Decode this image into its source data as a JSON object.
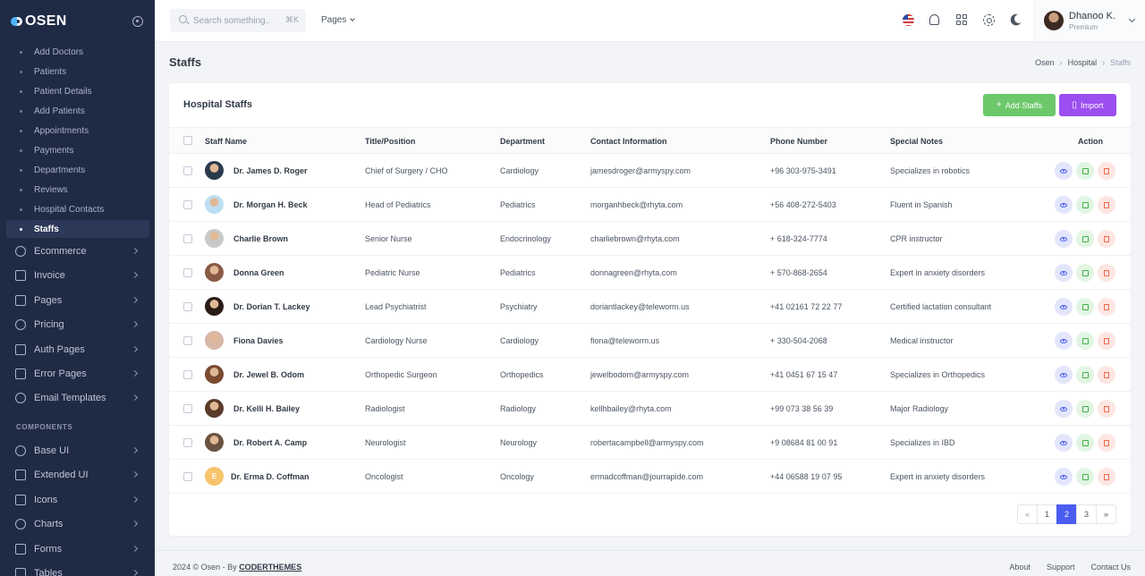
{
  "brand": {
    "logo_text": "OSEN"
  },
  "sidebar": {
    "sub_items": [
      {
        "label": "Add Doctors"
      },
      {
        "label": "Patients"
      },
      {
        "label": "Patient Details"
      },
      {
        "label": "Add Patients"
      },
      {
        "label": "Appointments"
      },
      {
        "label": "Payments"
      },
      {
        "label": "Departments"
      },
      {
        "label": "Reviews"
      },
      {
        "label": "Hospital Contacts"
      },
      {
        "label": "Staffs",
        "active": true
      }
    ],
    "items": [
      {
        "label": "Ecommerce",
        "icon": "bag-icon"
      },
      {
        "label": "Invoice",
        "icon": "invoice-icon"
      },
      {
        "label": "Pages",
        "icon": "pages-icon"
      },
      {
        "label": "Pricing",
        "icon": "pricing-icon"
      },
      {
        "label": "Auth Pages",
        "icon": "lock-icon"
      },
      {
        "label": "Error Pages",
        "icon": "error-icon"
      },
      {
        "label": "Email Templates",
        "icon": "email-icon"
      }
    ],
    "components_title": "COMPONENTS",
    "component_items": [
      {
        "label": "Base UI",
        "icon": "palette-icon"
      },
      {
        "label": "Extended UI",
        "icon": "layers-icon"
      },
      {
        "label": "Icons",
        "icon": "icons-icon"
      },
      {
        "label": "Charts",
        "icon": "chart-icon"
      },
      {
        "label": "Forms",
        "icon": "forms-icon"
      },
      {
        "label": "Tables",
        "icon": "table-icon"
      }
    ]
  },
  "topbar": {
    "search_placeholder": "Search something..",
    "search_shortcut": "⌘K",
    "pages_label": "Pages",
    "user": {
      "name": "Dhanoo K.",
      "role": "Premium"
    }
  },
  "page": {
    "title": "Staffs",
    "breadcrumb": [
      "Osen",
      "Hospital",
      "Staffs"
    ]
  },
  "card": {
    "title": "Hospital Staffs",
    "add_button": "Add Staffs",
    "import_button": "Import",
    "columns": [
      "Staff Name",
      "Title/Position",
      "Department",
      "Contact Information",
      "Phone Number",
      "Special Notes",
      "Action"
    ]
  },
  "staff": [
    {
      "name": "Dr. James D. Roger",
      "title": "Chief of Surgery / CHO",
      "department": "Cardiology",
      "email": "jamesdroger@armyspy.com",
      "phone": "+96 303-975-3491",
      "notes": "Specializes in robotics",
      "avatar_color": "#2b3a4a"
    },
    {
      "name": "Dr. Morgan H. Beck",
      "title": "Head of Pediatrics",
      "department": "Pediatrics",
      "email": "morganhbeck@rhyta.com",
      "phone": "+56 408-272-5403",
      "notes": "Fluent in Spanish",
      "avatar_color": "#bcdff2"
    },
    {
      "name": "Charlie Brown",
      "title": "Senior Nurse",
      "department": "Endocrinology",
      "email": "charliebrown@rhyta.com",
      "phone": "+ 618-324-7774",
      "notes": "CPR instructor",
      "avatar_color": "#c9c9c9"
    },
    {
      "name": "Donna Green",
      "title": "Pediatric Nurse",
      "department": "Pediatrics",
      "email": "donnagreen@rhyta.com",
      "phone": "+ 570-868-2654",
      "notes": "Expert in anxiety disorders",
      "avatar_color": "#8a5a44"
    },
    {
      "name": "Dr. Dorian T. Lackey",
      "title": "Lead Psychiatrist",
      "department": "Psychiatry",
      "email": "doriantlackey@teleworm.us",
      "phone": "+41 02161 72 22 77",
      "notes": "Certified lactation consultant",
      "avatar_color": "#2a1b16"
    },
    {
      "name": "Fiona Davies",
      "title": "Cardiology Nurse",
      "department": "Cardiology",
      "email": "fiona@teleworm.us",
      "phone": "+ 330-504-2068",
      "notes": "Medical instructor",
      "avatar_color": "#d8b7a6"
    },
    {
      "name": "Dr. Jewel B. Odom",
      "title": "Orthopedic Surgeon",
      "department": "Orthopedics",
      "email": "jewelbodom@armyspy.com",
      "phone": "+41 0451 67 15 47",
      "notes": "Specializes in Orthopedics",
      "avatar_color": "#7a4a30"
    },
    {
      "name": "Dr. Kelli H. Bailey",
      "title": "Radiologist",
      "department": "Radiology",
      "email": "kellhbailey@rhyta.com",
      "phone": "+99 073 38 56 39",
      "notes": "Major Radiology",
      "avatar_color": "#5a3a2a"
    },
    {
      "name": "Dr. Robert A. Camp",
      "title": "Neurologist",
      "department": "Neurology",
      "email": "robertacampbell@armyspy.com",
      "phone": "+9 08684 81 00 91",
      "notes": "Specializes in IBD",
      "avatar_color": "#6a5242"
    },
    {
      "name": "Dr. Erma D. Coffman",
      "title": "Oncologist",
      "department": "Oncology",
      "email": "ermadcoffman@jourrapide.com",
      "phone": "+44 06588 19 07 95",
      "notes": "Expert in anxiety disorders",
      "avatar_letter": "E"
    }
  ],
  "pagination": {
    "prev": "«",
    "pages": [
      "1",
      "2",
      "3"
    ],
    "current": "2",
    "next": "»"
  },
  "footer": {
    "copyright_prefix": "2024 © Osen - By",
    "copyright_link": "CODERTHEMES",
    "links": [
      "About",
      "Support",
      "Contact Us"
    ]
  }
}
